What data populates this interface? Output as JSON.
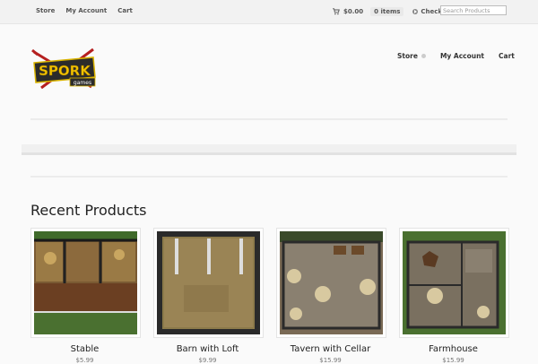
{
  "topbar": {
    "nav": [
      "Store",
      "My Account",
      "Cart"
    ],
    "cart_total": "$0.00",
    "cart_items": "0 items",
    "checkout": "Checkout",
    "search_placeholder": "Search Products"
  },
  "logo": {
    "text": "SPORK",
    "subtext": "games"
  },
  "mainnav": {
    "store": "Store",
    "account": "My Account",
    "cart": "Cart"
  },
  "section": {
    "title": "Recent Products"
  },
  "products": [
    {
      "name": "Stable",
      "price": "$5.99"
    },
    {
      "name": "Barn with Loft",
      "price": "$9.99"
    },
    {
      "name": "Tavern with Cellar",
      "price": "$15.99"
    },
    {
      "name": "Farmhouse",
      "price": "$15.99"
    }
  ]
}
